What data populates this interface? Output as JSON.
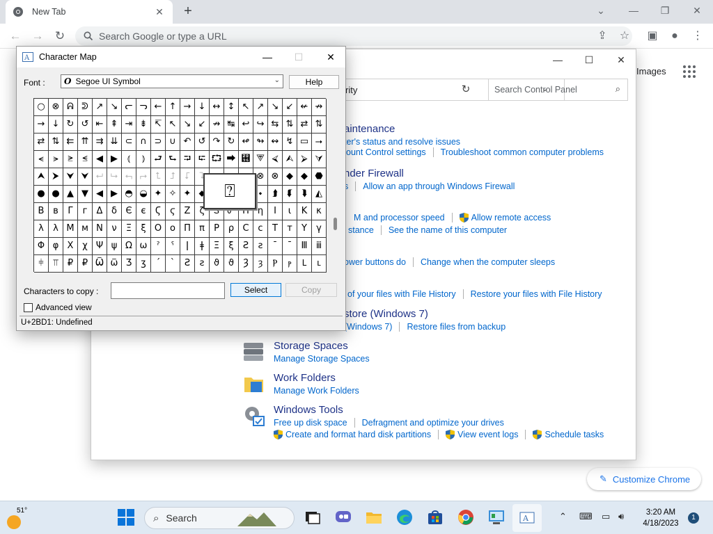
{
  "browser": {
    "tab_title": "New Tab",
    "omnibox_placeholder": "Search Google or type a URL",
    "ntp_images_link": "Images",
    "customize_label": "Customize Chrome"
  },
  "control_panel": {
    "address_text": "rity",
    "search_placeholder": "Search Control Panel",
    "sections": [
      {
        "heading": "aintenance",
        "links": [
          "ter's status and resolve issues"
        ]
      },
      {
        "links": [
          "ount Control settings",
          "Troubleshoot common computer problems"
        ]
      },
      {
        "heading": "nder Firewall",
        "links": [
          "s",
          "Allow an app through Windows Firewall"
        ]
      },
      {
        "links": [
          "M and processor speed",
          "Allow remote access"
        ]
      },
      {
        "links": [
          "stance",
          "See the name of this computer"
        ]
      },
      {
        "links": [
          "ower buttons do",
          "Change when the computer sleeps"
        ]
      },
      {
        "links": [
          "of your files with File History",
          "Restore your files with File History"
        ]
      },
      {
        "heading": "store (Windows 7)",
        "links": [
          "(Windows 7)",
          "Restore files from backup"
        ]
      },
      {
        "heading": "Storage Spaces",
        "links": [
          "Manage Storage Spaces"
        ]
      },
      {
        "heading": "Work Folders",
        "links": [
          "Manage Work Folders"
        ]
      },
      {
        "heading": "Windows Tools",
        "links": [
          "Free up disk space",
          "Defragment and optimize your drives"
        ]
      },
      {
        "links": [
          "Create and format hard disk partitions",
          "View event logs",
          "Schedule tasks"
        ]
      }
    ]
  },
  "charmap": {
    "title": "Character Map",
    "font_label": "Font :",
    "font_value": "Segoe UI Symbol",
    "help_label": "Help",
    "grid": [
      [
        "○",
        "⊗",
        "ᕱ",
        "ᕲ",
        "↗",
        "↘",
        "ᓕ",
        "ᓓ",
        "←",
        "↑",
        "→",
        "↓",
        "↔",
        "↕",
        "↖",
        "↗",
        "↘",
        "↙",
        "↚",
        "↛"
      ],
      [
        "→",
        "↓",
        "↻",
        "↺",
        "⇤",
        "⇞",
        "⇥",
        "⇟",
        "↸",
        "↖",
        "↘",
        "↙",
        "↛",
        "↹",
        "↩",
        "↪",
        "⇆",
        "⇅",
        "⇄",
        "⇅"
      ],
      [
        "⇄",
        "⇅",
        "⇇",
        "⇈",
        "⇉",
        "⇊",
        "⊂",
        "∩",
        "⊃",
        "∪",
        "↶",
        "↺",
        "↷",
        "↻",
        "↫",
        "↬",
        "↭",
        "↯",
        "▭",
        "⭢"
      ],
      [
        "⪪",
        "⪫",
        "⪭",
        "⪬",
        "◀",
        "▶",
        "⦅",
        "⦆",
        "⮐",
        "⮑",
        "⮒",
        "⮓",
        "⮔",
        "⮕",
        "⮖",
        "⮗",
        "⮘",
        "⮙",
        "⮚",
        "⮛"
      ],
      [
        "⮝",
        "⮞",
        "⮟",
        "⮟",
        "⮠",
        "⮡",
        "⮢",
        "⮣",
        "⮤",
        "⮥",
        "⮦",
        "⮧",
        "⮨",
        "⮩",
        "⮪",
        "⊗",
        "⊗",
        "◆",
        "◆",
        "⬣"
      ],
      [
        "●",
        "●",
        "▲",
        "▼",
        "◀",
        "▶",
        "◓",
        "◒",
        "✦",
        "✧",
        "✦",
        "⬥",
        "⬦",
        "⬧",
        "⬨",
        "⬩",
        "⮭",
        "⮮",
        "⮯",
        "◭"
      ],
      [
        "Β",
        "в",
        "Γ",
        "г",
        "Δ",
        "δ",
        "Є",
        "є",
        "Ϛ",
        "ϛ",
        "Ζ",
        "ζ",
        "Ꮪ",
        "Ꮫ",
        "Η",
        "η",
        "Ι",
        "ι",
        "Κ",
        "κ"
      ],
      [
        "λ",
        "λ",
        "Μ",
        "м",
        "Ν",
        "ν",
        "Ξ",
        "ξ",
        "Ο",
        "ο",
        "Π",
        "π",
        "Ρ",
        "ρ",
        "С",
        "с",
        "Т",
        "т",
        "Υ",
        "γ"
      ],
      [
        "Φ",
        "φ",
        "Χ",
        "χ",
        "Ψ",
        "ψ",
        "Ω",
        "ω",
        "ˀ",
        "ˁ",
        "ǀ",
        "ǂ",
        "Ξ",
        "ξ",
        "Ƨ",
        "ƨ",
        "ˉ",
        "ˉ",
        "Ⅲ",
        "ⅲ"
      ],
      [
        "⫩",
        "⫪",
        "₽",
        "₽",
        "Ѿ",
        "ѿ",
        "Ʒ",
        "ʒ",
        "ˊ",
        "ˋ",
        "Ƨ",
        "ƨ",
        "ϑ",
        "ϑ",
        "Ȝ",
        "ȝ",
        "Ⲣ",
        "ⲣ",
        "Ⳑ",
        "ⳑ"
      ]
    ],
    "zoom_glyph": "⍰",
    "copy_label": "Characters to copy :",
    "copy_value": "",
    "select_label": "Select",
    "copy_button_label": "Copy",
    "advanced_view_label": "Advanced view",
    "status": "U+2BD1: Undefined"
  },
  "taskbar": {
    "weather_temp": "51°",
    "search_label": "Search",
    "time": "3:20 AM",
    "date": "4/18/2023",
    "notification_count": "1"
  },
  "colors": {
    "link": "#0066cc",
    "heading": "#1e3287",
    "accent": "#1a73e8"
  }
}
